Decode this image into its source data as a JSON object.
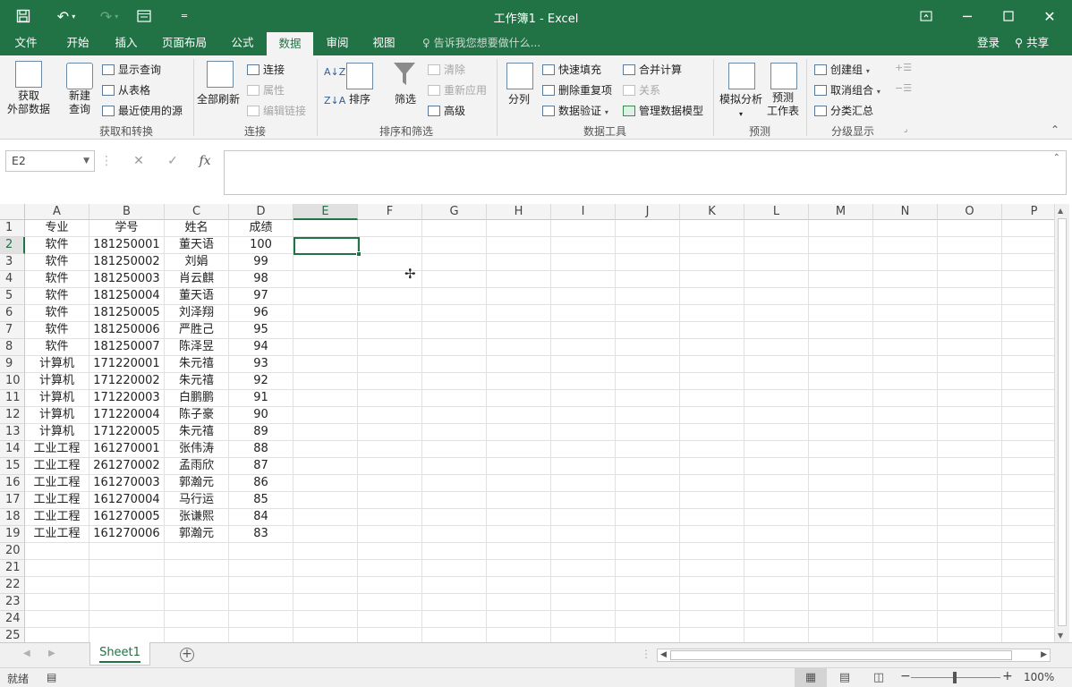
{
  "app": {
    "title": "工作簿1 - Excel"
  },
  "titlebar": {
    "save_icon": "save-icon",
    "undo_icon": "undo-icon",
    "redo_icon": "redo-icon",
    "form_icon": "form-icon",
    "customize_icon": "customize-qat-icon"
  },
  "menu": {
    "tabs": [
      "文件",
      "开始",
      "插入",
      "页面布局",
      "公式",
      "数据",
      "审阅",
      "视图"
    ],
    "active": "数据",
    "tell_me": "告诉我您想要做什么...",
    "login": "登录",
    "share": "共享"
  },
  "ribbon": {
    "get_external": "获取\n外部数据",
    "new_query": "新建\n查询",
    "show_query": "显示查询",
    "from_table": "从表格",
    "recent_sources": "最近使用的源",
    "refresh_all": "全部刷新",
    "connections": "连接",
    "properties": "属性",
    "edit_links": "编辑链接",
    "sort": "排序",
    "filter": "筛选",
    "clear": "清除",
    "reapply": "重新应用",
    "advanced": "高级",
    "text_to_columns": "分列",
    "flash_fill": "快速填充",
    "remove_duplicates": "删除重复项",
    "data_validation": "数据验证",
    "consolidate": "合并计算",
    "relationships": "关系",
    "manage_data_model": "管理数据模型",
    "what_if": "模拟分析",
    "forecast_sheet": "预测\n工作表",
    "group": "创建组",
    "ungroup": "取消组合",
    "subtotal": "分类汇总",
    "groups": {
      "get_transform": "获取和转换",
      "connections": "连接",
      "sort_filter": "排序和筛选",
      "data_tools": "数据工具",
      "forecast": "预测",
      "outline": "分级显示"
    }
  },
  "formula_bar": {
    "name_box": "E2",
    "cancel": "✕",
    "enter": "✓",
    "fx": "fx",
    "formula": ""
  },
  "sheet": {
    "columns": [
      "A",
      "B",
      "C",
      "D",
      "E",
      "F",
      "G",
      "H",
      "I",
      "J",
      "K",
      "L",
      "M",
      "N",
      "O",
      "P"
    ],
    "row_numbers": [
      "1",
      "2",
      "3",
      "4",
      "5",
      "6",
      "7",
      "8",
      "9",
      "10",
      "11",
      "12",
      "13",
      "14",
      "15",
      "16",
      "17",
      "18",
      "19",
      "20",
      "21",
      "22",
      "23",
      "24",
      "25"
    ],
    "selected_cell": "E2",
    "rows": [
      [
        "专业",
        "学号",
        "姓名",
        "成绩"
      ],
      [
        "软件",
        "181250001",
        "董天语",
        "100"
      ],
      [
        "软件",
        "181250002",
        "刘娟",
        "99"
      ],
      [
        "软件",
        "181250003",
        "肖云麒",
        "98"
      ],
      [
        "软件",
        "181250004",
        "董天语",
        "97"
      ],
      [
        "软件",
        "181250005",
        "刘泽翔",
        "96"
      ],
      [
        "软件",
        "181250006",
        "严胜己",
        "95"
      ],
      [
        "软件",
        "181250007",
        "陈泽昱",
        "94"
      ],
      [
        "计算机",
        "171220001",
        "朱元禧",
        "93"
      ],
      [
        "计算机",
        "171220002",
        "朱元禧",
        "92"
      ],
      [
        "计算机",
        "171220003",
        "白鹏鹏",
        "91"
      ],
      [
        "计算机",
        "171220004",
        "陈子豪",
        "90"
      ],
      [
        "计算机",
        "171220005",
        "朱元禧",
        "89"
      ],
      [
        "工业工程",
        "161270001",
        "张伟涛",
        "88"
      ],
      [
        "工业工程",
        "261270002",
        "孟雨欣",
        "87"
      ],
      [
        "工业工程",
        "161270003",
        "郭瀚元",
        "86"
      ],
      [
        "工业工程",
        "161270004",
        "马行运",
        "85"
      ],
      [
        "工业工程",
        "161270005",
        "张谦熙",
        "84"
      ],
      [
        "工业工程",
        "161270006",
        "郭瀚元",
        "83"
      ]
    ],
    "sheet_tab": "Sheet1"
  },
  "status": {
    "ready": "就绪",
    "zoom": "100%"
  },
  "colors": {
    "accent": "#217346"
  }
}
